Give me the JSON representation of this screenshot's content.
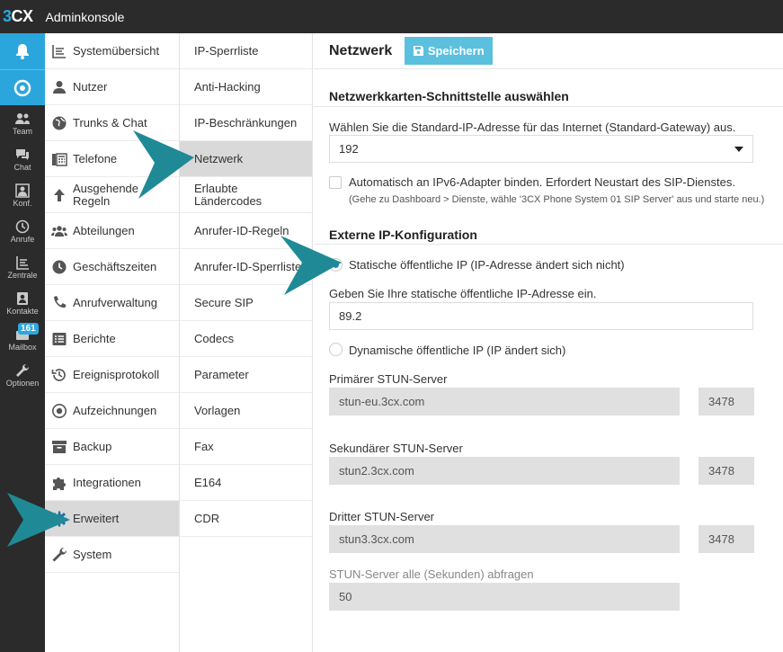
{
  "topbar": {
    "logo_3": "3",
    "logo_cx": "CX",
    "title": "Adminkonsole"
  },
  "rail": {
    "items": [
      {
        "label": "Team",
        "icon": "team-icon"
      },
      {
        "label": "Chat",
        "icon": "chat-icon"
      },
      {
        "label": "Konf.",
        "icon": "conference-icon"
      },
      {
        "label": "Anrufe",
        "icon": "calls-icon"
      },
      {
        "label": "Zentrale",
        "icon": "switchboard-icon"
      },
      {
        "label": "Kontakte",
        "icon": "contacts-icon"
      },
      {
        "label": "Mailbox",
        "icon": "mailbox-icon",
        "badge": "161"
      },
      {
        "label": "Optionen",
        "icon": "wrench-icon"
      }
    ]
  },
  "nav1": {
    "items": [
      {
        "label": "Systemübersicht",
        "icon": "dashboard-icon"
      },
      {
        "label": "Nutzer",
        "icon": "user-icon"
      },
      {
        "label": "Trunks & Chat",
        "icon": "globe-icon"
      },
      {
        "label": "Telefone",
        "icon": "phone-device-icon"
      },
      {
        "label": "Ausgehende Regeln",
        "icon": "arrow-up-icon"
      },
      {
        "label": "Abteilungen",
        "icon": "group-icon"
      },
      {
        "label": "Geschäftszeiten",
        "icon": "clock-icon"
      },
      {
        "label": "Anrufverwaltung",
        "icon": "handset-icon"
      },
      {
        "label": "Berichte",
        "icon": "list-icon"
      },
      {
        "label": "Ereignisprotokoll",
        "icon": "history-icon"
      },
      {
        "label": "Aufzeichnungen",
        "icon": "record-icon"
      },
      {
        "label": "Backup",
        "icon": "archive-icon"
      },
      {
        "label": "Integrationen",
        "icon": "puzzle-icon"
      },
      {
        "label": "Erweitert",
        "icon": "gear-icon",
        "active": true
      },
      {
        "label": "System",
        "icon": "wrench-icon"
      }
    ]
  },
  "nav2": {
    "items": [
      {
        "label": "IP-Sperrliste"
      },
      {
        "label": "Anti-Hacking"
      },
      {
        "label": "IP-Beschränkungen"
      },
      {
        "label": "Netzwerk",
        "active": true
      },
      {
        "label": "Erlaubte Ländercodes"
      },
      {
        "label": "Anrufer-ID-Regeln"
      },
      {
        "label": "Anrufer-ID-Sperrliste"
      },
      {
        "label": "Secure SIP"
      },
      {
        "label": "Codecs"
      },
      {
        "label": "Parameter"
      },
      {
        "label": "Vorlagen"
      },
      {
        "label": "Fax"
      },
      {
        "label": "E164"
      },
      {
        "label": "CDR"
      }
    ]
  },
  "main": {
    "title": "Netzwerk",
    "save_label": "Speichern",
    "nic_section": {
      "title": "Netzwerkkarten-Schnittstelle auswählen",
      "gateway_label": "Wählen Sie die Standard-IP-Adresse für das Internet (Standard-Gateway) aus.",
      "gateway_value": "192",
      "ipv6_label": "Automatisch an IPv6-Adapter binden. Erfordert Neustart des SIP-Dienstes.",
      "ipv6_hint": "(Gehe zu Dashboard > Dienste, wähle '3CX Phone System 01 SIP Server' aus und starte neu.)"
    },
    "ext_section": {
      "title": "Externe IP-Konfiguration",
      "static_label": "Statische öffentliche IP (IP-Adresse ändert sich nicht)",
      "static_ip_label": "Geben Sie Ihre statische öffentliche IP-Adresse ein.",
      "static_ip_value": "89.2",
      "dynamic_label": "Dynamische öffentliche IP (IP ändert sich)",
      "stun1_label": "Primärer STUN-Server",
      "stun1_host": "stun-eu.3cx.com",
      "stun1_port": "3478",
      "stun2_label": "Sekundärer STUN-Server",
      "stun2_host": "stun2.3cx.com",
      "stun2_port": "3478",
      "stun3_label": "Dritter STUN-Server",
      "stun3_host": "stun3.3cx.com",
      "stun3_port": "3478",
      "poll_label": "STUN-Server alle (Sekunden) abfragen",
      "poll_value": "50"
    }
  },
  "colors": {
    "accent": "#2aa6dd",
    "arrow": "#1f8a96",
    "save_button": "#5bc0de",
    "topbar": "#2b2b2b"
  }
}
